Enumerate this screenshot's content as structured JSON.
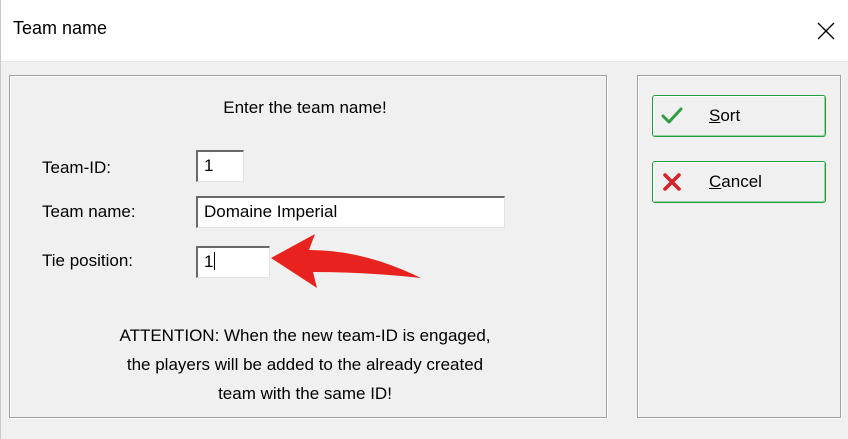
{
  "window": {
    "title": "Team name"
  },
  "form": {
    "heading": "Enter the team name!",
    "team_id_label": "Team-ID:",
    "team_id_value": "1",
    "team_name_label": "Team name:",
    "team_name_value": "Domaine Imperial",
    "tie_label": "Tie position:",
    "tie_value": "1",
    "note_line1": "ATTENTION: When the new team-ID is engaged,",
    "note_line2": "the players will be added to the already created",
    "note_line3": "team with the same ID!"
  },
  "buttons": {
    "sort_mnemonic": "S",
    "sort_rest": "ort",
    "cancel_mnemonic": "C",
    "cancel_rest": "ancel",
    "sort_icon": "checkmark-icon",
    "cancel_icon": "red-x-icon"
  },
  "colors": {
    "button_border": "#1f9e3c",
    "check_green": "#2e9e3f",
    "cancel_red": "#d8222a",
    "annotation_arrow": "#e8231f"
  }
}
